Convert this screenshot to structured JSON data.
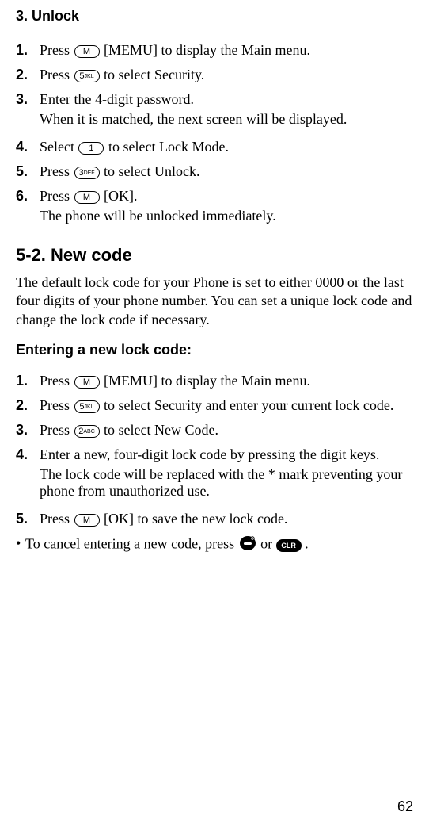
{
  "unlock": {
    "title": "3. Unlock",
    "steps": [
      {
        "num": "1.",
        "text_before": "Press ",
        "key": "M",
        "text_after": " [MEMU] to display the Main menu."
      },
      {
        "num": "2.",
        "text_before": "Press ",
        "key": "5JKL",
        "keynum": "5",
        "keylabel": "JKL",
        "text_after": " to select Security."
      },
      {
        "num": "3.",
        "line1": "Enter the 4-digit password.",
        "line2": "When it is matched, the next screen will be displayed."
      },
      {
        "num": "4.",
        "text_before": "Select ",
        "key": "1",
        "keynum": "1",
        "keylabel": "",
        "text_after": " to select Lock Mode."
      },
      {
        "num": "5.",
        "text_before": "Press ",
        "key": "3DEF",
        "keynum": "3",
        "keylabel": "DEF",
        "text_after": " to select Unlock."
      },
      {
        "num": "6.",
        "text_before": "Press ",
        "key": "M",
        "text_after": " [OK].",
        "line2": "The phone will be unlocked immediately."
      }
    ]
  },
  "newcode": {
    "title": "5-2. New code",
    "intro": "The default lock code for your Phone is set to either 0000 or the last four digits of your phone number. You can set a unique lock code and change the lock code if necessary.",
    "subheading": "Entering a new lock code:",
    "steps": [
      {
        "num": "1.",
        "text_before": "Press ",
        "key": "M",
        "text_after": " [MEMU] to display the Main menu."
      },
      {
        "num": "2.",
        "text_before": "Press ",
        "key": "5JKL",
        "keynum": "5",
        "keylabel": "JKL",
        "text_after": " to select Security and enter your current lock code."
      },
      {
        "num": "3.",
        "text_before": "Press ",
        "key": "2ABC",
        "keynum": "2",
        "keylabel": "ABC",
        "text_after": " to select New Code."
      },
      {
        "num": "4.",
        "line1": "Enter a new, four-digit lock code by pressing the digit keys.",
        "line2_a": "The lock code will be replaced with the ",
        "line2_star": "*",
        "line2_b": " mark preventing your phone from unauthorized use."
      },
      {
        "num": "5.",
        "text_before": "Press ",
        "key": "M",
        "text_after": " [OK] to save the new lock code."
      }
    ],
    "note_before": "To cancel entering a new code, press ",
    "note_mid": " or ",
    "note_after": " .",
    "clr_label": "CLR"
  },
  "page": "62"
}
